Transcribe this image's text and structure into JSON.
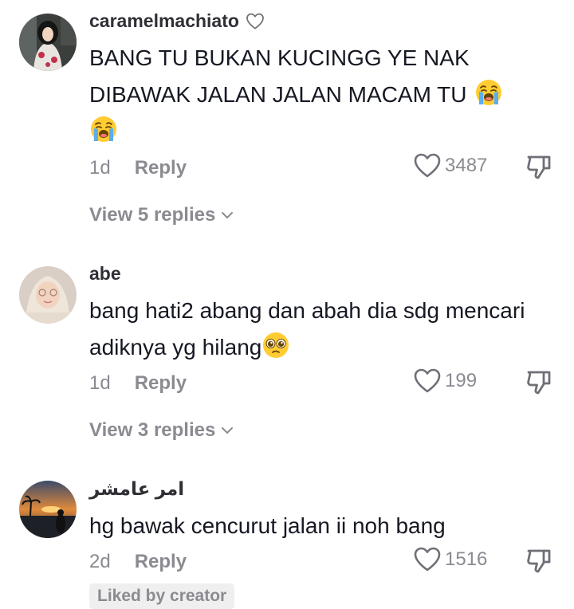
{
  "comments": [
    {
      "username": "caramelmachiato",
      "text": "BANG TU BUKAN KUCINGG YE NAK DIBAWAK JALAN JALAN MACAM TU",
      "time": "1d",
      "reply_label": "Reply",
      "likes": "3487",
      "view_replies": "View 5 replies",
      "emoji": "loudly-crying-face"
    },
    {
      "username": "abe",
      "text": "bang hati2 abang dan abah dia sdg mencari adiknya yg hilang",
      "time": "1d",
      "reply_label": "Reply",
      "likes": "199",
      "view_replies": "View 3 replies",
      "emoji": "pleading-face"
    },
    {
      "username": "امر عامشر",
      "text": "hg bawak cencurut jalan ii noh bang",
      "time": "2d",
      "reply_label": "Reply",
      "likes": "1516",
      "badge": "Liked by creator"
    }
  ],
  "icons": {
    "like": "heart-outline-icon",
    "dislike": "thumbs-down-icon",
    "expand": "chevron-down-icon"
  },
  "colors": {
    "text": "#161823",
    "secondary": "#8a8b91",
    "badge_bg": "#efefef"
  }
}
